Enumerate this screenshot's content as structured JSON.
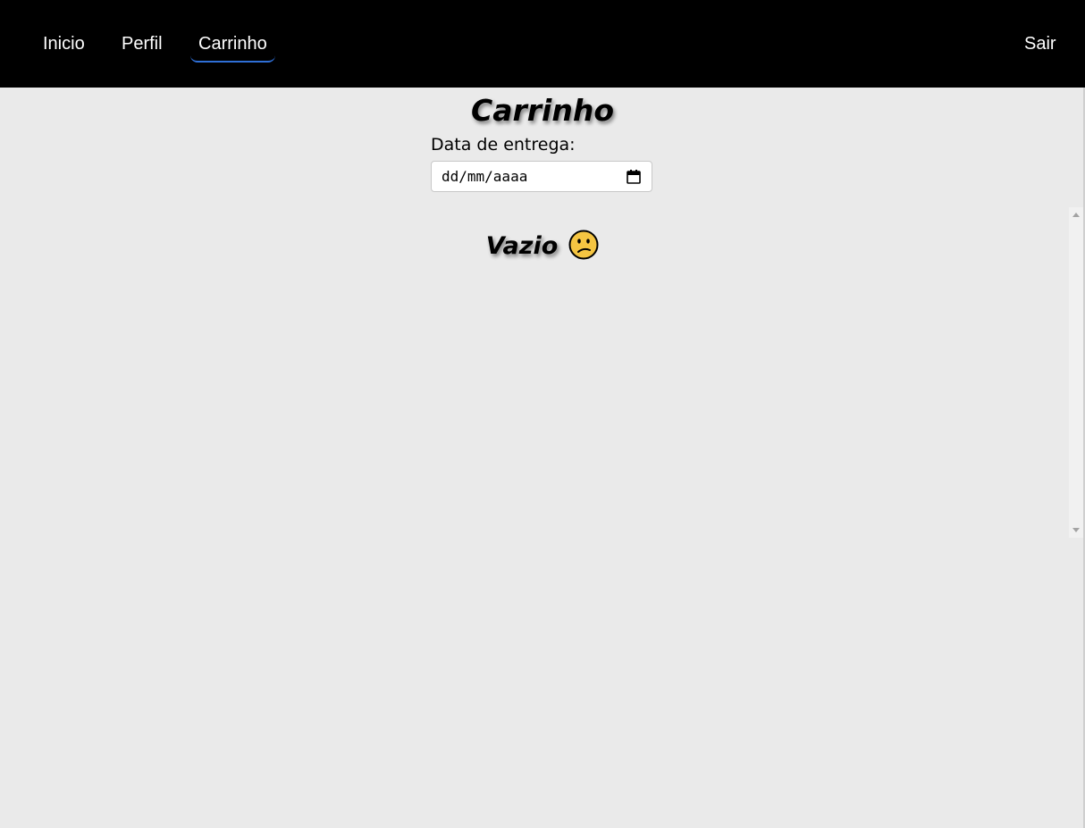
{
  "nav": {
    "items": [
      {
        "label": "Inicio",
        "active": false
      },
      {
        "label": "Perfil",
        "active": false
      },
      {
        "label": "Carrinho",
        "active": true
      }
    ],
    "logout_label": "Sair"
  },
  "cart": {
    "title": "Carrinho",
    "delivery_date_label": "Data de entrega:",
    "delivery_date_placeholder": "dd/mm/aaaa",
    "empty_message": "Vazio",
    "empty_emoji_icon": "confused-face-icon"
  },
  "colors": {
    "topbar_bg": "#000000",
    "page_bg": "#eaeaea",
    "active_tab_accent": "#2f6fd6",
    "emoji_fill": "#f5c542"
  }
}
